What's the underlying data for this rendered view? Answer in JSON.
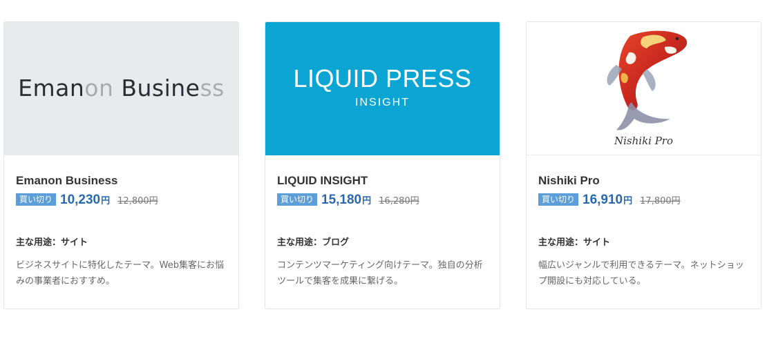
{
  "cards": [
    {
      "logo_text_dark_1": "Eman",
      "logo_text_light_1": "on",
      "logo_text_dark_2": " Busine",
      "logo_text_light_2": "ss",
      "title": "Emanon Business",
      "badge": "買い切り",
      "price": "10,230",
      "yen": "円",
      "old_price": "12,800円",
      "usage": "主な用途：サイト",
      "description": "ビジネスサイトに特化したテーマ。Web集客にお悩みの事業者におすすめ。",
      "thumb_color": "#e9eaec"
    },
    {
      "logo_main": "LIQUID PRESS",
      "logo_sub": "INSIGHT",
      "title": "LIQUID INSIGHT",
      "badge": "買い切り",
      "price": "15,180",
      "yen": "円",
      "old_price": "16,280円",
      "usage": "主な用途：ブログ",
      "description": "コンテンツマーケティング向けテーマ。独自の分析ツールで集客を成果に繋げる。",
      "thumb_color": "#0aa5d2"
    },
    {
      "logo_text": "Nishiki Pro",
      "title": "Nishiki Pro",
      "badge": "買い切り",
      "price": "16,910",
      "yen": "円",
      "old_price": "17,800円",
      "usage": "主な用途：サイト",
      "description": "幅広いジャンルで利用できるテーマ。ネットショップ開設にも対応している。",
      "thumb_color": "#ffffff"
    }
  ],
  "colors": {
    "badge": "#5c9ed8",
    "price": "#2868b0",
    "border": "#e4e4e4"
  }
}
